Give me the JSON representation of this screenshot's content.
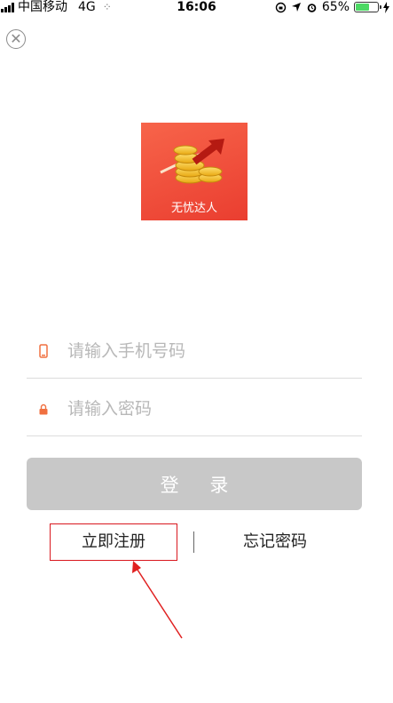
{
  "status_bar": {
    "carrier": "中国移动",
    "network": "4G",
    "time": "16:06",
    "battery": "65%",
    "battery_level": 0.65
  },
  "logo": {
    "brand": "无忧达人"
  },
  "form": {
    "phone_placeholder": "请输入手机号码",
    "password_placeholder": "请输入密码",
    "login_label": "登 录"
  },
  "links": {
    "register": "立即注册",
    "forgot": "忘记密码"
  },
  "colors": {
    "accent": "#ea3e30",
    "highlight": "#d9181f",
    "button_disabled": "#c8c8c8",
    "battery": "#4cd964"
  }
}
